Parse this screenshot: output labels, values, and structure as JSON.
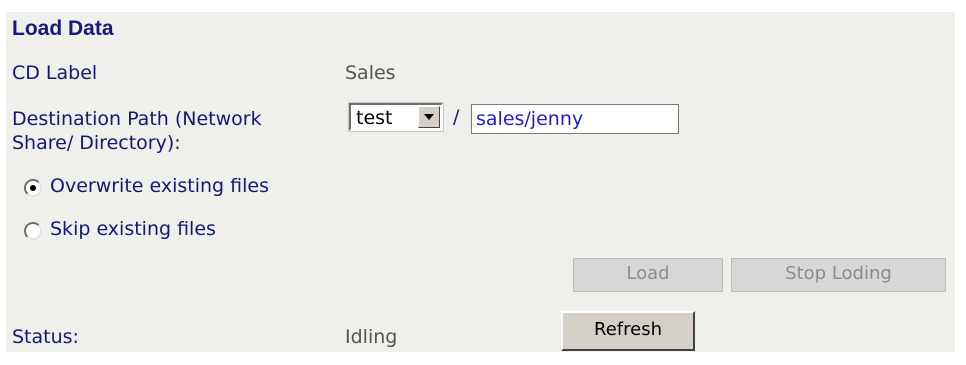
{
  "section_title": "Load Data",
  "cd_label": {
    "label": "CD Label",
    "value": "Sales"
  },
  "destination": {
    "label_line1": "Destination Path (Network",
    "label_line2": "Share/ Directory):",
    "share_select_value": "test",
    "separator": "/",
    "directory_value": "sales/jenny"
  },
  "options": {
    "overwrite_label": "Overwrite existing files",
    "skip_label": "Skip existing files",
    "selected": "overwrite"
  },
  "buttons": {
    "load_label": "Load",
    "stop_label": "Stop Loding",
    "refresh_label": "Refresh"
  },
  "status": {
    "label": "Status:",
    "value": "Idling"
  },
  "icons": {
    "select_arrow": "chevron-down-icon",
    "radio_selected": "radio-selected-icon",
    "radio_unselected": "radio-unselected-icon"
  }
}
